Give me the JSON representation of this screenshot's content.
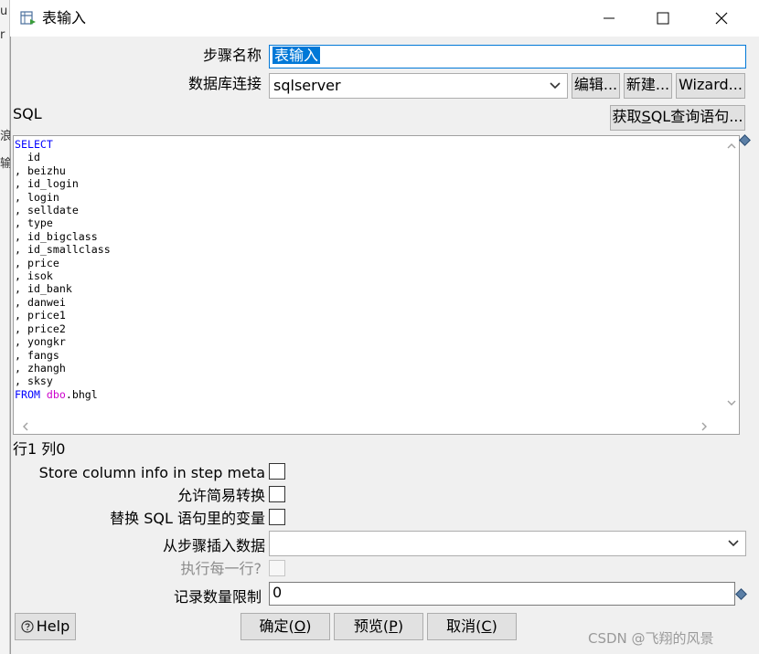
{
  "background_window": {
    "fragments": [
      "u",
      "r",
      "浪",
      "输"
    ]
  },
  "window": {
    "title": "表输入",
    "minimize_glyph": "—",
    "maximize_glyph": "☐",
    "close_glyph": "✕"
  },
  "form": {
    "step_name_label": "步骤名称",
    "step_name_value": "表输入",
    "db_conn_label": "数据库连接",
    "db_conn_value": "sqlserver",
    "edit_button": "编辑...",
    "new_button": "新建...",
    "wizard_button": "Wizard...",
    "sql_label": "SQL",
    "get_sql_button_prefix": "获取",
    "get_sql_button_mnemonic": "S",
    "get_sql_button_suffix": "QL查询语句..."
  },
  "sql": {
    "keyword_select": "SELECT",
    "columns": [
      "  id",
      ", beizhu",
      ", id_login",
      ", login",
      ", selldate",
      ", type",
      ", id_bigclass",
      ", id_smallclass",
      ", price",
      ", isok",
      ", id_bank",
      ", danwei",
      ", price1",
      ", price2",
      ", yongkr",
      ", fangs",
      ", zhangh",
      ", sksy"
    ],
    "keyword_from": "FROM",
    "schema": "dbo",
    "table": ".bhgl"
  },
  "status": {
    "position": "行1 列0"
  },
  "options": {
    "store_column_info_label": "Store column info in step meta",
    "store_column_info_checked": false,
    "lazy_conversion_label": "允许简易转换",
    "lazy_conversion_checked": false,
    "replace_vars_label": "替换 SQL 语句里的变量",
    "replace_vars_checked": false,
    "insert_from_step_label": "从步骤插入数据",
    "insert_from_step_value": "",
    "execute_each_row_label": "执行每一行?",
    "execute_each_row_checked": false,
    "limit_label": "记录数量限制",
    "limit_value": "0"
  },
  "footer": {
    "help_button": "Help",
    "ok_text": "确定(",
    "ok_mnemonic": "O",
    "ok_close": ")",
    "preview_text": "预览(",
    "preview_mnemonic": "P",
    "preview_close": ")",
    "cancel_text": "取消(",
    "cancel_mnemonic": "C",
    "cancel_close": ")"
  },
  "watermark": "CSDN @飞翔的风景",
  "colors": {
    "accent": "#0078d7",
    "sql_keyword": "#0000ff",
    "sql_schema": "#cc00cc",
    "dialog_bg": "#f0f0f0"
  }
}
